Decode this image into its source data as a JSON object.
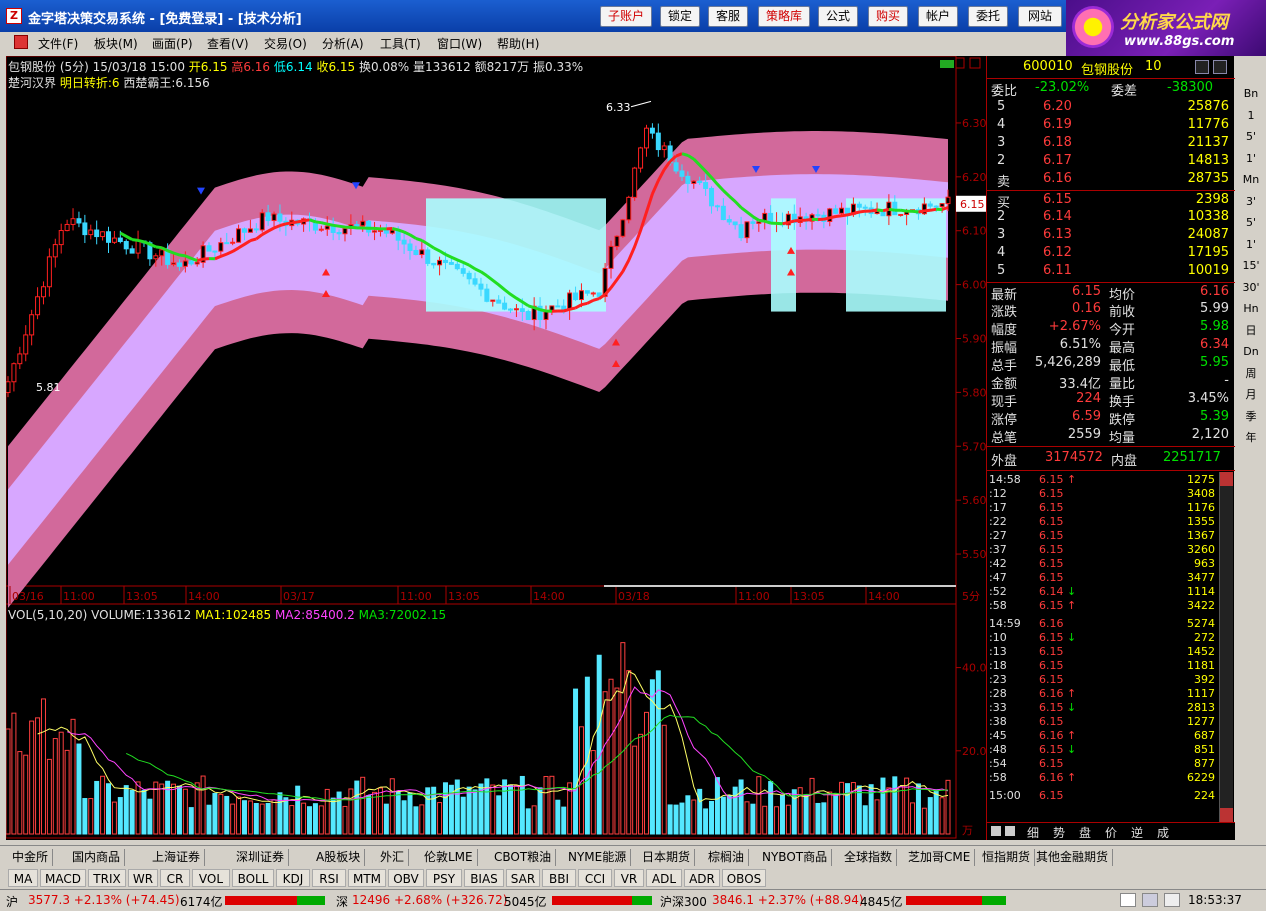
{
  "window": {
    "title": "金字塔决策交易系统 - [免费登录] - [技术分析]",
    "toolbar_buttons": [
      "子账户",
      "锁定",
      "客服",
      "策略库",
      "公式",
      "购买",
      "帐户",
      "委托",
      "网站"
    ]
  },
  "logo": {
    "title": "分析家公式网",
    "url": "www.88gs.com"
  },
  "menu": [
    "文件(F)",
    "板块(M)",
    "画面(P)",
    "查看(V)",
    "交易(O)",
    "分析(A)",
    "工具(T)",
    "窗口(W)",
    "帮助(H)"
  ],
  "chart": {
    "header1": {
      "name": "包钢股份 (5分)",
      "date": "15/03/18 15:00",
      "open": "开6.15",
      "high": "高6.16",
      "low": "低6.14",
      "close": "收6.15",
      "turnover": "换0.08%",
      "volume": "量133612",
      "amount": "额8217万",
      "amplitude": "振0.33%"
    },
    "header2": {
      "indicator": "楚河汉界",
      "line1": "明日转折:6",
      "line2": "西楚霸王:6.156"
    },
    "price_axis": [
      "6.30",
      "6.20",
      "6.10",
      "6.00",
      "5.90",
      "5.80",
      "5.70",
      "5.60",
      "5.50"
    ],
    "last_price_tag": "6.15",
    "high_label": "6.33",
    "low_label": "5.81",
    "time_axis": [
      "03/16",
      "11:00",
      "13:05",
      "14:00",
      "03/17",
      "11:00",
      "13:05",
      "14:00",
      "03/18",
      "11:00",
      "13:05",
      "14:00"
    ],
    "period": "5分",
    "volume_header": {
      "name": "VOL(5,10,20)",
      "volume": "VOLUME:133612",
      "ma1": "MA1:102485",
      "ma2": "MA2:85400.2",
      "ma3": "MA3:72002.15"
    },
    "volume_axis": [
      "40.0",
      "20.0"
    ],
    "volume_unit": "万"
  },
  "chart_data": {
    "type": "candlestick",
    "title": "包钢股份 (5分)",
    "ylim": [
      5.45,
      6.35
    ],
    "x_ticks": [
      "03/16",
      "11:00",
      "13:05",
      "14:00",
      "03/17",
      "11:00",
      "13:05",
      "14:00",
      "03/18",
      "11:00",
      "13:05",
      "14:00"
    ],
    "high": 6.33,
    "low": 5.81,
    "last": 6.15
  },
  "quote": {
    "code": "600010",
    "name": "包钢股份",
    "size": "10",
    "ratio_label": "委比",
    "ratio": "-23.02%",
    "diff_label": "委差",
    "diff": "-38300",
    "sells": [
      {
        "level": "5",
        "price": "6.20",
        "vol": "25876"
      },
      {
        "level": "4",
        "price": "6.19",
        "vol": "11776"
      },
      {
        "level": "3",
        "price": "6.18",
        "vol": "21137"
      },
      {
        "level": "2",
        "price": "6.17",
        "vol": "14813"
      },
      {
        "level": "卖",
        "price": "6.16",
        "vol": "28735"
      }
    ],
    "buys": [
      {
        "level": "买",
        "price": "6.15",
        "vol": "2398"
      },
      {
        "level": "2",
        "price": "6.14",
        "vol": "10338"
      },
      {
        "level": "3",
        "price": "6.13",
        "vol": "24087"
      },
      {
        "level": "4",
        "price": "6.12",
        "vol": "17195"
      },
      {
        "level": "5",
        "price": "6.11",
        "vol": "10019"
      }
    ],
    "stats": [
      {
        "l1": "最新",
        "v1": "6.15",
        "l2": "均价",
        "v2": "6.16",
        "c1": "red",
        "c2": "red"
      },
      {
        "l1": "涨跌",
        "v1": "0.16",
        "l2": "前收",
        "v2": "5.99",
        "c1": "red",
        "c2": "white"
      },
      {
        "l1": "幅度",
        "v1": "+2.67%",
        "l2": "今开",
        "v2": "5.98",
        "c1": "red",
        "c2": "green"
      },
      {
        "l1": "振幅",
        "v1": "6.51%",
        "l2": "最高",
        "v2": "6.34",
        "c1": "white",
        "c2": "red"
      },
      {
        "l1": "总手",
        "v1": "5,426,289",
        "l2": "最低",
        "v2": "5.95",
        "c1": "white",
        "c2": "green"
      },
      {
        "l1": "金额",
        "v1": "33.4亿",
        "l2": "量比",
        "v2": "-",
        "c1": "white",
        "c2": "white"
      },
      {
        "l1": "现手",
        "v1": "224",
        "l2": "换手",
        "v2": "3.45%",
        "c1": "red",
        "c2": "white"
      },
      {
        "l1": "涨停",
        "v1": "6.59",
        "l2": "跌停",
        "v2": "5.39",
        "c1": "red",
        "c2": "green"
      },
      {
        "l1": "总笔",
        "v1": "2559",
        "l2": "均量",
        "v2": "2,120",
        "c1": "white",
        "c2": "white"
      }
    ],
    "outer_label": "外盘",
    "outer": "3174572",
    "inner_label": "内盘",
    "inner": "2251717",
    "ticks": [
      {
        "t": "14:58",
        "p": "6.15",
        "d": "↑",
        "v": "1275",
        "dc": "red"
      },
      {
        "t": ":12",
        "p": "6.15",
        "d": "",
        "v": "3408",
        "dc": "red"
      },
      {
        "t": ":17",
        "p": "6.15",
        "d": "",
        "v": "1176",
        "dc": "red"
      },
      {
        "t": ":22",
        "p": "6.15",
        "d": "",
        "v": "1355",
        "dc": "red"
      },
      {
        "t": ":27",
        "p": "6.15",
        "d": "",
        "v": "1367",
        "dc": "red"
      },
      {
        "t": ":37",
        "p": "6.15",
        "d": "",
        "v": "3260",
        "dc": "red"
      },
      {
        "t": ":42",
        "p": "6.15",
        "d": "",
        "v": "963",
        "dc": "red"
      },
      {
        "t": ":47",
        "p": "6.15",
        "d": "",
        "v": "3477",
        "dc": "red"
      },
      {
        "t": ":52",
        "p": "6.14",
        "d": "↓",
        "v": "1114",
        "dc": "green"
      },
      {
        "t": ":58",
        "p": "6.15",
        "d": "↑",
        "v": "3422",
        "dc": "red"
      },
      {
        "t": "14:59",
        "p": "6.16",
        "d": "",
        "v": "5274",
        "dc": "red"
      },
      {
        "t": ":10",
        "p": "6.15",
        "d": "↓",
        "v": "272",
        "dc": "green"
      },
      {
        "t": ":13",
        "p": "6.15",
        "d": "",
        "v": "1452",
        "dc": "green"
      },
      {
        "t": ":18",
        "p": "6.15",
        "d": "",
        "v": "1181",
        "dc": "green"
      },
      {
        "t": ":23",
        "p": "6.15",
        "d": "",
        "v": "392",
        "dc": "green"
      },
      {
        "t": ":28",
        "p": "6.16",
        "d": "↑",
        "v": "1117",
        "dc": "red"
      },
      {
        "t": ":33",
        "p": "6.15",
        "d": "↓",
        "v": "2813",
        "dc": "green"
      },
      {
        "t": ":38",
        "p": "6.15",
        "d": "",
        "v": "1277",
        "dc": "green"
      },
      {
        "t": ":45",
        "p": "6.16",
        "d": "↑",
        "v": "687",
        "dc": "red"
      },
      {
        "t": ":48",
        "p": "6.15",
        "d": "↓",
        "v": "851",
        "dc": "green"
      },
      {
        "t": ":54",
        "p": "6.15",
        "d": "",
        "v": "877",
        "dc": "green"
      },
      {
        "t": ":58",
        "p": "6.16",
        "d": "↑",
        "v": "6229",
        "dc": "red"
      },
      {
        "t": "15:00",
        "p": "6.15",
        "d": "",
        "v": "224",
        "dc": "red"
      }
    ],
    "bottom_tabs": [
      "细",
      "势",
      "盘",
      "价",
      "逆",
      "成"
    ]
  },
  "side_tabs": [
    "Bn",
    "1",
    "5'",
    "1'",
    "Mn",
    "3'",
    "5'",
    "1'",
    "15'",
    "30'",
    "Hn",
    "日",
    "Dn",
    "周",
    "月",
    "季",
    "年"
  ],
  "market_tabs": [
    "中金所",
    "国内商品",
    "上海证券",
    "深圳证券",
    "A股板块",
    "外汇",
    "伦敦LME",
    "CBOT粮油",
    "NYME能源",
    "日本期货",
    "棕榈油",
    "NYBOT商品",
    "全球指数",
    "芝加哥CME",
    "恒指期货",
    "其他金融期货"
  ],
  "indicator_tabs": [
    "MA",
    "MACD",
    "TRIX",
    "WR",
    "CR",
    "VOL",
    "BOLL",
    "KDJ",
    "RSI",
    "MTM",
    "OBV",
    "PSY",
    "BIAS",
    "SAR",
    "BBI",
    "CCI",
    "VR",
    "ADL",
    "ADR",
    "OBOS"
  ],
  "status": {
    "sh_label": "沪",
    "sh": "3577.3 +2.13% (+74.45)",
    "sh_amt": "6174亿",
    "sz_label": "深",
    "sz": "12496 +2.68% (+326.72)",
    "sz_amt": "5045亿",
    "hs_label": "沪深300",
    "hs": "3846.1 +2.37% (+88.94)",
    "hs_amt": "4845亿",
    "time": "18:53:37"
  },
  "colors": {
    "up": "#ff3b3b",
    "down": "#00e8e8",
    "band_outer": "#d2699b",
    "band_inner": "#d7a7ff",
    "band_cyan": "#aaffff",
    "line_up": "#ff2020",
    "line_down": "#22dd22"
  }
}
